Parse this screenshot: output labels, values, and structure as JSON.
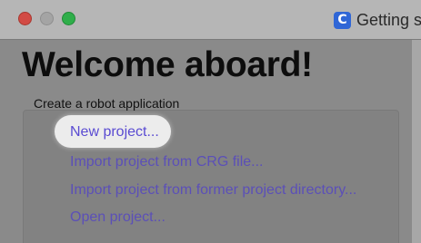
{
  "window": {
    "title": "Getting s",
    "app_icon_letter": "C"
  },
  "welcome": {
    "heading": "Welcome aboard!",
    "group_label": "Create a robot application"
  },
  "actions": [
    {
      "label": "New project...",
      "highlighted": true
    },
    {
      "label": "Import project from CRG file..."
    },
    {
      "label": "Import project from former project directory..."
    },
    {
      "label": "Open project..."
    }
  ],
  "colors": {
    "link": "#5b4fb8",
    "close": "#d24b45",
    "maximize": "#2fae4a",
    "app_icon": "#2f66d6"
  }
}
